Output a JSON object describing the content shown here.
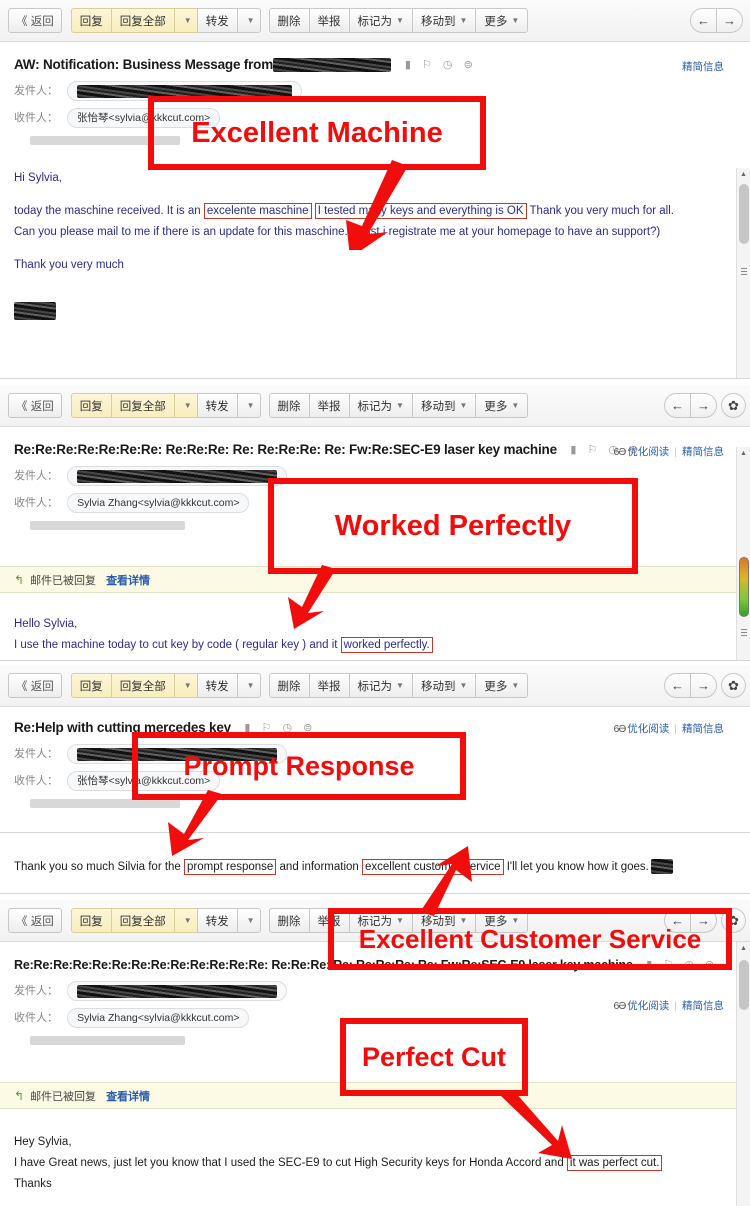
{
  "toolbar": {
    "back": "《 返回",
    "reply": "回复",
    "reply_all": "回复全部",
    "forward": "转发",
    "delete": "删除",
    "report": "举报",
    "mark_as": "标记为",
    "move_to": "移动到",
    "more": "更多",
    "prev_icon": "←",
    "next_icon": "→",
    "gear_icon": "✿"
  },
  "labels": {
    "from": "发件人：",
    "to": "收件人：",
    "optimized_read": "优化阅读",
    "simplified_info": "精简信息",
    "glasses_icon": "6Ə",
    "replied_notice": "邮件已被回复",
    "view_details": "查看详情",
    "recipient": "Sylvia Zhang<sylvia@kkkcut.com>",
    "recipient_cn": "张怡琴<sylvia@kkkcut.com>",
    "header_icons": "▮ ⚐ ◷ ⊜"
  },
  "panels": [
    {
      "id": "panel-1",
      "subject": "AW: Notification: Business Message from",
      "body": [
        {
          "text": "Hi Sylvia,"
        },
        {
          "text": ""
        },
        {
          "segments": [
            {
              "t": "today the maschine received. It is an ",
              "hl": false
            },
            {
              "t": "excelente maschine",
              "hl": true
            },
            {
              "t": " ",
              "hl": false
            },
            {
              "t": "I tested many keys and everything is OK",
              "hl": true
            },
            {
              "t": " Thank you very much for all.",
              "hl": false
            }
          ]
        },
        {
          "text": "Can you please mail to me if there is an update for this maschine. (must i registrate me at your homepage to have an support?)"
        },
        {
          "text": ""
        },
        {
          "text": "Thank you very much"
        }
      ]
    },
    {
      "id": "panel-2",
      "subject": "Re:Re:Re:Re:Re:Re:Re: Re:Re:Re: Re: Re:Re:Re: Re: Fw:Re:SEC-E9 laser key machine",
      "body": [
        {
          "text": "Hello Sylvia,"
        },
        {
          "segments": [
            {
              "t": "I use the machine today to cut key by code ( regular key ) and it ",
              "hl": false
            },
            {
              "t": "worked perfectly.",
              "hl": true
            }
          ]
        }
      ]
    },
    {
      "id": "panel-3",
      "subject": "Re:Help with cutting mercedes key",
      "body": [
        {
          "segments": [
            {
              "t": "Thank you so much Silvia for the ",
              "hl": false
            },
            {
              "t": "prompt response",
              "hl": true
            },
            {
              "t": " and information ",
              "hl": false
            },
            {
              "t": "excellent customer service",
              "hl": true
            },
            {
              "t": " I'll let you know how it goes.",
              "hl": false
            }
          ]
        }
      ]
    },
    {
      "id": "panel-4",
      "subject": "Re:Re:Re:Re:Re:Re:Re:Re:Re:Re:Re:Re:Re: Re:Re:Re: Re: Re:Re:Re: Re: Fw:Re:SEC-E9 laser key machine",
      "body": [
        {
          "text": "Hey Sylvia,"
        },
        {
          "segments": [
            {
              "t": "I have Great news, just let you know that I used the SEC-E9 to cut High Security keys for Honda Accord and ",
              "hl": false
            },
            {
              "t": "it was perfect cut.",
              "hl": true
            }
          ]
        },
        {
          "text": "Thanks"
        }
      ]
    }
  ],
  "annotations": [
    {
      "id": "ann-excellent-machine",
      "text": "Excellent Machine"
    },
    {
      "id": "ann-worked-perfectly",
      "text": "Worked Perfectly"
    },
    {
      "id": "ann-prompt-response",
      "text": "Prompt Response"
    },
    {
      "id": "ann-excellent-customer-service",
      "text": "Excellent Customer Service"
    },
    {
      "id": "ann-perfect-cut",
      "text": "Perfect Cut"
    }
  ],
  "colors": {
    "annotation_red": "#f20d0d",
    "link_blue": "#2a5db0",
    "body_text": "#2b2b8f",
    "notice_bg": "#fcfae4"
  }
}
